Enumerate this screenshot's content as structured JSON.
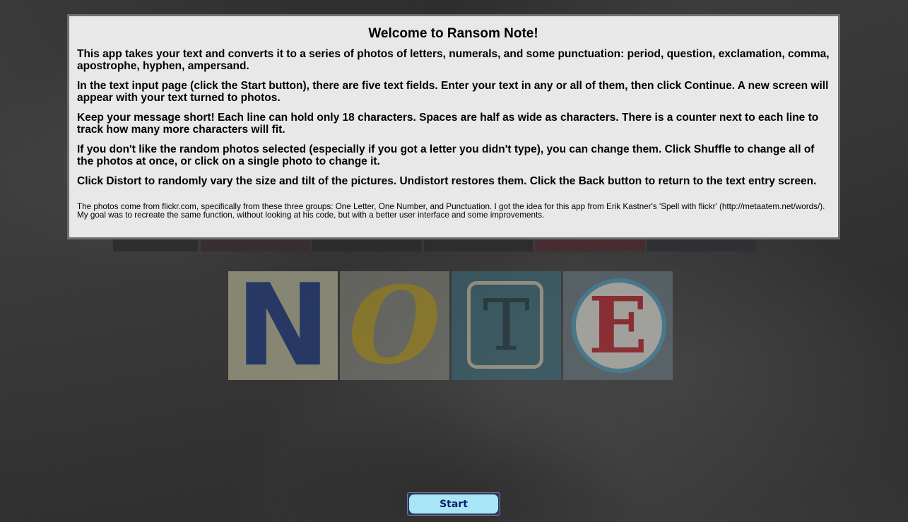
{
  "background": {
    "note_photos": [
      {
        "letter": "N",
        "glyph_color": "#1b3a8c"
      },
      {
        "letter": "O",
        "glyph_color": "#c7a826"
      },
      {
        "letter": "T",
        "glyph_color": "#1d3b44"
      },
      {
        "letter": "E",
        "glyph_color": "#c42029"
      }
    ]
  },
  "dialog": {
    "title": "Welcome to Ransom Note!",
    "paragraphs": [
      "This app takes your text and converts it to a series of photos of letters, numerals, and some punctuation: period, question, exclamation, comma, apostrophe, hyphen, ampersand.",
      "In the text input page (click the Start button), there are five text fields. Enter your text in any or all of them, then click Continue. A new screen will appear with your text turned to photos.",
      "Keep your message short! Each line can hold only 18 characters. Spaces are half as wide as characters. There is a counter next to each line to track how many more characters will fit.",
      "If you don't like the random photos selected (especially if you got a letter you didn't type), you can change them. Click Shuffle to change all of the photos at once, or click on a single photo to change it.",
      "Click Distort to randomly vary the size and tilt of the pictures. Undistort restores them. Click the Back button to return to the text entry screen."
    ],
    "credit": "The photos come from flickr.com, specifically from these three groups: One Letter, One Number, and Punctuation. I got the idea for this app from Erik Kastner's 'Spell with flickr' (http://metaatem.net/words/). My goal was to recreate the same function, without looking at his code, but with a better user interface and some improvements."
  },
  "start_button": {
    "label": "Start",
    "color": "#a8e6f7"
  }
}
